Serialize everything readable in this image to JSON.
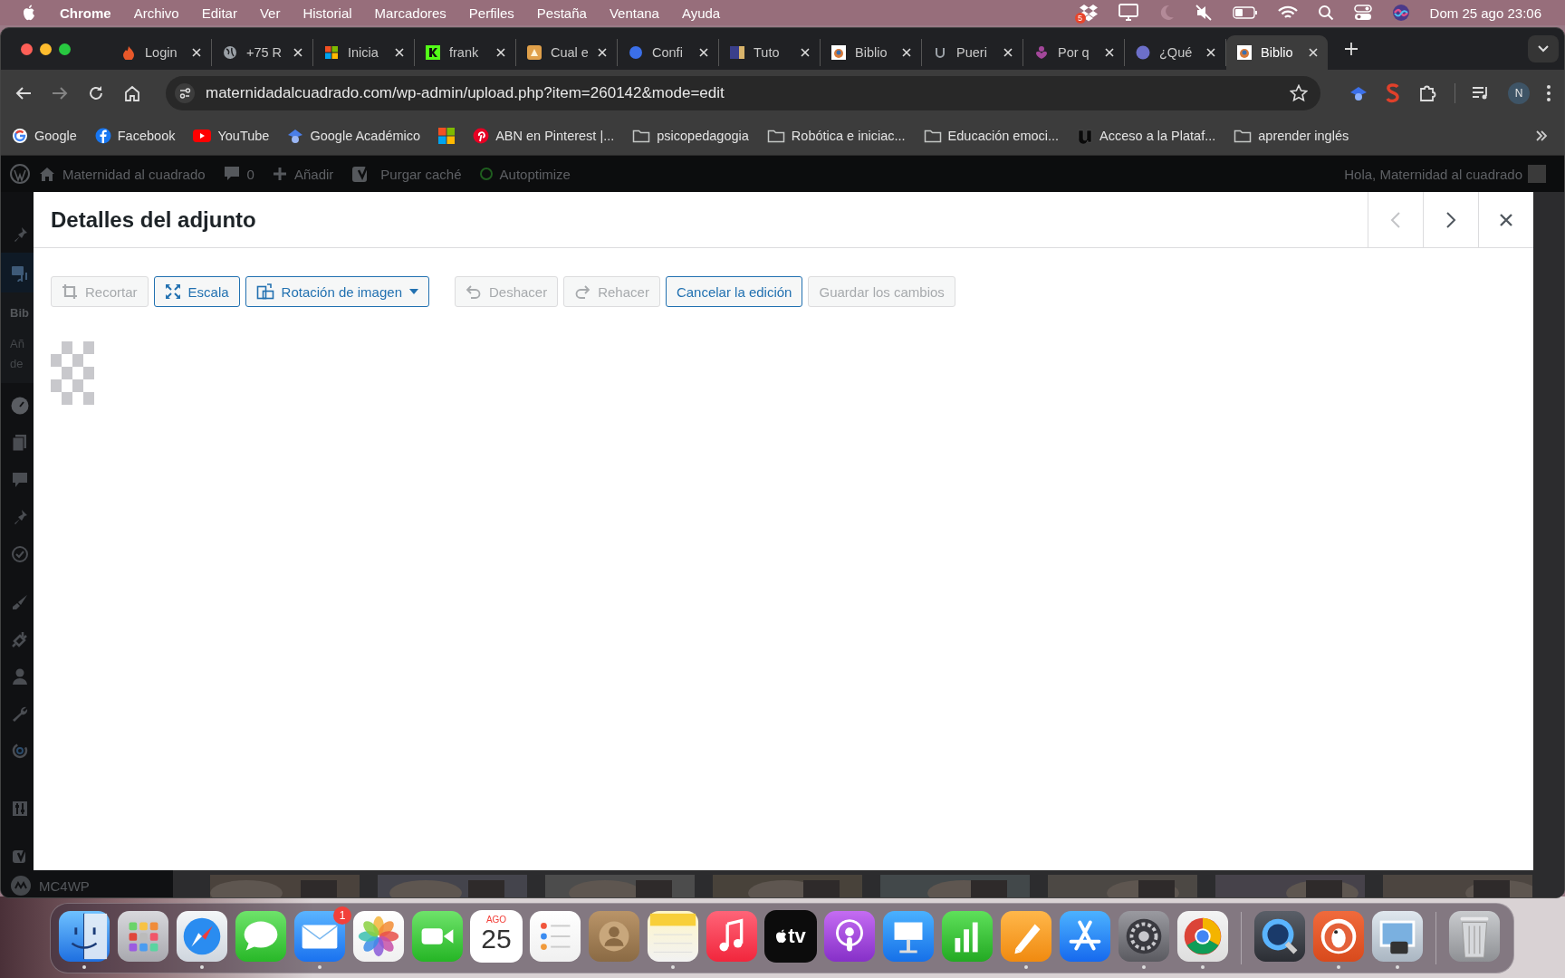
{
  "menu_bar": {
    "app": "Chrome",
    "menus": [
      "Archivo",
      "Editar",
      "Ver",
      "Historial",
      "Marcadores",
      "Perfiles",
      "Pestaña",
      "Ventana",
      "Ayuda"
    ],
    "dropbox_badge": "5",
    "clock": "Dom 25 ago 23:06"
  },
  "tabs": [
    {
      "title": "Login",
      "selected": false
    },
    {
      "title": "+75 R",
      "selected": false
    },
    {
      "title": "Inicia",
      "selected": false
    },
    {
      "title": "frank",
      "selected": false
    },
    {
      "title": "Cual e",
      "selected": false
    },
    {
      "title": "Confi",
      "selected": false
    },
    {
      "title": "Tuto",
      "selected": false
    },
    {
      "title": "Biblio",
      "selected": false
    },
    {
      "title": "Pueri",
      "selected": false
    },
    {
      "title": "Por q",
      "selected": false
    },
    {
      "title": "¿Qué",
      "selected": false
    },
    {
      "title": "Biblio",
      "selected": true
    }
  ],
  "toolbar": {
    "url": "maternidadalcuadrado.com/wp-admin/upload.php?item=260142&mode=edit",
    "forward_disabled": true,
    "profile_initial": "N"
  },
  "bookmarks": [
    {
      "kind": "google",
      "label": "Google"
    },
    {
      "kind": "facebook",
      "label": "Facebook"
    },
    {
      "kind": "youtube",
      "label": "YouTube"
    },
    {
      "kind": "scholar",
      "label": "Google Académico"
    },
    {
      "kind": "microsoft"
    },
    {
      "kind": "pinterest",
      "label": "ABN en Pinterest |..."
    },
    {
      "kind": "folder",
      "label": "psicopedagogia"
    },
    {
      "kind": "folder",
      "label": "Robótica e iniciac..."
    },
    {
      "kind": "folder",
      "label": "Educación emoci..."
    },
    {
      "kind": "u",
      "label": "Acceso a la Plataf..."
    },
    {
      "kind": "folder",
      "label": "aprender inglés"
    }
  ],
  "admin_bar": {
    "site": "Maternidad al cuadrado",
    "comments": "0",
    "add": "Añadir",
    "purge": "Purgar caché",
    "autoptimize": "Autoptimize",
    "greeting": "Hola, Maternidad al cuadrado"
  },
  "sidebar": {
    "heading": "Bib",
    "sub_items": [
      "Añ",
      "de"
    ],
    "footer": "MC4WP"
  },
  "modal": {
    "title": "Detalles del adjunto",
    "nav": [
      {
        "kind": "prev",
        "disabled": true
      },
      {
        "kind": "next",
        "disabled": false
      }
    ],
    "tools": [
      {
        "kind": "crop",
        "label": "Recortar",
        "disabled": true
      },
      {
        "kind": "scale",
        "label": "Escala",
        "disabled": false
      },
      {
        "kind": "rotate",
        "label": "Rotación de imagen",
        "disabled": false
      },
      {
        "kind": "undo",
        "label": "Deshacer",
        "disabled": true
      },
      {
        "kind": "redo",
        "label": "Rehacer",
        "disabled": true
      },
      {
        "kind": "cancel",
        "label": "Cancelar la edición",
        "disabled": false
      },
      {
        "kind": "save",
        "label": "Guardar los cambios",
        "disabled": true
      }
    ]
  },
  "dock": [
    {
      "kind": "finder",
      "running": true
    },
    {
      "kind": "launchpad",
      "running": false
    },
    {
      "kind": "safari",
      "running": true
    },
    {
      "kind": "messages",
      "running": false
    },
    {
      "kind": "mail",
      "running": true,
      "badge": "1"
    },
    {
      "kind": "photos",
      "running": false
    },
    {
      "kind": "facetime",
      "running": false
    },
    {
      "kind": "calendar",
      "running": false,
      "month": "AGO",
      "day": "25"
    },
    {
      "kind": "reminders",
      "running": false
    },
    {
      "kind": "contacts",
      "running": false
    },
    {
      "kind": "notes",
      "running": true
    },
    {
      "kind": "music",
      "running": false
    },
    {
      "kind": "tv",
      "running": false,
      "label": "tv"
    },
    {
      "kind": "podcasts",
      "running": false
    },
    {
      "kind": "keynote",
      "running": false
    },
    {
      "kind": "numbers",
      "running": false
    },
    {
      "kind": "pages",
      "running": true
    },
    {
      "kind": "appstore",
      "running": false
    },
    {
      "kind": "settings",
      "running": true
    },
    {
      "kind": "chrome",
      "running": true
    },
    {
      "kind": "separator"
    },
    {
      "kind": "quicktime",
      "running": false
    },
    {
      "kind": "duckduckgo",
      "running": true
    },
    {
      "kind": "preview",
      "running": true
    },
    {
      "kind": "separator"
    },
    {
      "kind": "trash",
      "running": false
    }
  ]
}
